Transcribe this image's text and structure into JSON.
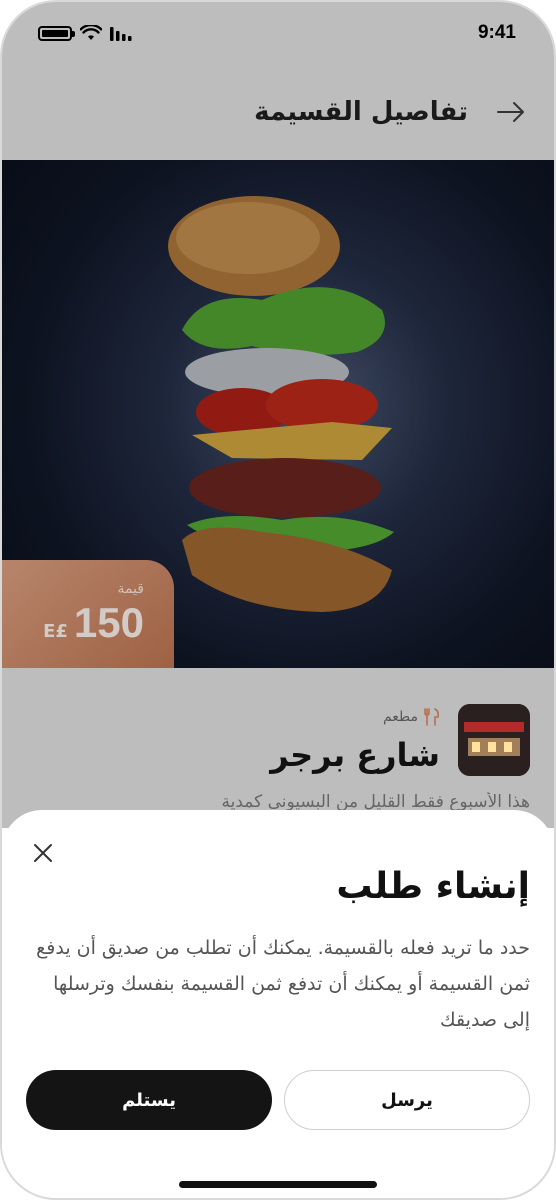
{
  "status_bar": {
    "time": "9:41"
  },
  "header": {
    "title": "تفاصيل القسيمة"
  },
  "voucher": {
    "price_label": "قيمة",
    "price_value": "150",
    "currency": "E£"
  },
  "restaurant": {
    "type": "مطعم",
    "name": "شارع برجر",
    "description": "هذا الأسبوع فقط القليل من البسيوني كمدية"
  },
  "sheet": {
    "title": "إنشاء طلب",
    "body": "حدد ما تريد فعله بالقسيمة. يمكنك أن تطلب من صديق أن يدفع ثمن القسيمة أو يمكنك أن تدفع ثمن القسيمة بنفسك وترسلها إلى صديقك",
    "send_label": "يرسل",
    "receive_label": "يستلم"
  },
  "colors": {
    "accent": "#b8704a",
    "primary_button": "#141414",
    "overlay": "#bdbdbd"
  }
}
